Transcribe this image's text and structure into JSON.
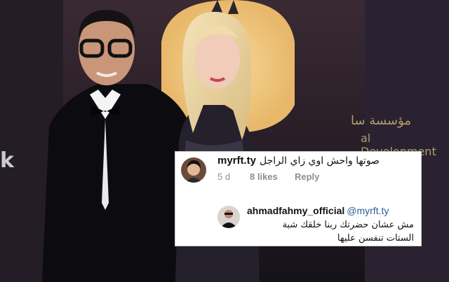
{
  "background": {
    "sign_arabic": "مؤسسة سا",
    "sign_english": "al Development",
    "sign_left": "k"
  },
  "comment": {
    "username": "myrft.ty",
    "text": "صوتها واحش اوي زاي الراجل",
    "age": "5 d",
    "likes": "8 likes",
    "reply_label": "Reply"
  },
  "reply": {
    "username": "ahmadfahmy_official",
    "mention": "@myrft.ty",
    "text_line1": "مش عشان حضرتك ربنا خلقك شبة",
    "text_line2": "الستات تنفسن عليها"
  }
}
